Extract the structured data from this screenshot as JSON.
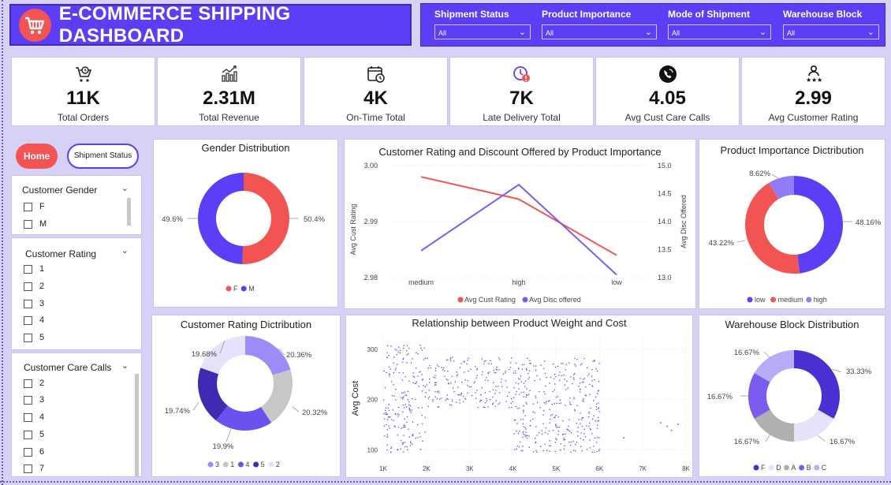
{
  "header": {
    "title": "E-COMMERCE SHIPPING DASHBOARD"
  },
  "filters": [
    {
      "label": "Shipment Status",
      "value": "All"
    },
    {
      "label": "Product Importance",
      "value": "All"
    },
    {
      "label": "Mode of Shipment",
      "value": "All"
    },
    {
      "label": "Warehouse Block",
      "value": "All"
    }
  ],
  "kpis": [
    {
      "value": "11K",
      "label": "Total Orders",
      "icon": "cart-clock-icon"
    },
    {
      "value": "2.31M",
      "label": "Total Revenue",
      "icon": "revenue-chart-icon"
    },
    {
      "value": "4K",
      "label": "On-Time Total",
      "icon": "calendar-clock-icon"
    },
    {
      "value": "7K",
      "label": "Late Delivery Total",
      "icon": "late-clock-icon"
    },
    {
      "value": "4.05",
      "label": "Avg Cust Care Calls",
      "icon": "phone-icon"
    },
    {
      "value": "2.99",
      "label": "Avg Customer Rating",
      "icon": "rating-person-icon"
    }
  ],
  "nav": {
    "home": "Home",
    "shipment": "Shipment Status"
  },
  "slicers": {
    "gender": {
      "title": "Customer Gender",
      "items": [
        "F",
        "M"
      ]
    },
    "rating": {
      "title": "Customer Rating",
      "items": [
        "1",
        "2",
        "3",
        "4",
        "5"
      ]
    },
    "calls": {
      "title": "Customer Care Calls",
      "items": [
        "2",
        "3",
        "4",
        "5",
        "6",
        "7"
      ]
    }
  },
  "colors": {
    "accent": "#5b3ef5",
    "red": "#f25454"
  },
  "chart_data": [
    {
      "id": "gender",
      "type": "pie",
      "title": "Gender Distribution",
      "slices": [
        {
          "label": "F",
          "value": 50.4,
          "display": "50.4%",
          "color": "#f25454"
        },
        {
          "label": "M",
          "value": 49.6,
          "display": "49.6%",
          "color": "#5b3ef5"
        }
      ],
      "legend": [
        "F",
        "M"
      ]
    },
    {
      "id": "rating_discount",
      "type": "line",
      "title": "Customer Rating and Discount Offered by Product Importance",
      "categories": [
        "medium",
        "high",
        "low"
      ],
      "series": [
        {
          "name": "Avg Cust Rating",
          "values": [
            2.998,
            2.994,
            2.984
          ],
          "axis": "left",
          "color": "#f25454"
        },
        {
          "name": "Avg Disc offered",
          "values": [
            13.48,
            14.66,
            13.05
          ],
          "axis": "right",
          "color": "#7b5cf0"
        }
      ],
      "ylabel": "Avg Cust Rating",
      "y2label": "Avg Disc Offered",
      "ylim": [
        2.98,
        3.0
      ],
      "y2lim": [
        13.0,
        15.0
      ],
      "yticks": [
        "2.98",
        "2.99",
        "3.00"
      ],
      "y2ticks": [
        "13.0",
        "13.5",
        "14.0",
        "14.5",
        "15.0"
      ]
    },
    {
      "id": "importance",
      "type": "pie",
      "title": "Product Importance Dictribution",
      "slices": [
        {
          "label": "low",
          "value": 48.16,
          "display": "48.16%",
          "color": "#5b3ef5"
        },
        {
          "label": "medium",
          "value": 43.22,
          "display": "43.22%",
          "color": "#f25454"
        },
        {
          "label": "high",
          "value": 8.62,
          "display": "8.62%",
          "color": "#8f7cf6"
        }
      ],
      "legend": [
        "low",
        "medium",
        "high"
      ]
    },
    {
      "id": "rating_dist",
      "type": "pie",
      "title": "Customer Rating Dictribution",
      "slices": [
        {
          "label": "3",
          "value": 20.36,
          "display": "20.36%",
          "color": "#9d8cf7"
        },
        {
          "label": "1",
          "value": 20.32,
          "display": "20.32%",
          "color": "#c7c7c7"
        },
        {
          "label": "4",
          "value": 19.9,
          "display": "19.9%",
          "color": "#6c50f0"
        },
        {
          "label": "5",
          "value": 19.74,
          "display": "19.74%",
          "color": "#3f2bb3"
        },
        {
          "label": "2",
          "value": 19.68,
          "display": "19.68%",
          "color": "#e5e2fb"
        }
      ],
      "legend": [
        "3",
        "1",
        "4",
        "5",
        "2"
      ]
    },
    {
      "id": "weight_cost",
      "type": "scatter",
      "title": "Relationship between Product Weight and Cost",
      "ylabel": "Avg Cost",
      "xlim": [
        1000,
        8000
      ],
      "ylim": [
        85,
        320
      ],
      "xticks": [
        "1K",
        "2K",
        "3K",
        "4K",
        "5K",
        "6K",
        "7K",
        "8K"
      ],
      "yticks": [
        "100",
        "200",
        "300"
      ],
      "clusters": [
        {
          "xrange": [
            1000,
            2000
          ],
          "yrange": [
            96,
            310
          ]
        },
        {
          "xrange": [
            2000,
            4000
          ],
          "yrange": [
            185,
            285
          ]
        },
        {
          "xrange": [
            4000,
            6000
          ],
          "yrange": [
            96,
            285
          ]
        }
      ],
      "outliers": [
        [
          6550,
          125
        ],
        [
          7400,
          155
        ],
        [
          7550,
          148
        ],
        [
          7650,
          140
        ],
        [
          7800,
          152
        ]
      ],
      "color": "#5b3ef5"
    },
    {
      "id": "warehouse",
      "type": "pie",
      "title": "Warehouse Block Distribution",
      "slices": [
        {
          "label": "F",
          "value": 33.33,
          "display": "33.33%",
          "color": "#4a2fd1"
        },
        {
          "label": "D",
          "value": 16.67,
          "display": "16.67%",
          "color": "#e5e2fb"
        },
        {
          "label": "A",
          "value": 16.67,
          "display": "16.67%",
          "color": "#b0b0b0"
        },
        {
          "label": "B",
          "value": 16.67,
          "display": "16.67%",
          "color": "#7b5cf0"
        },
        {
          "label": "C",
          "value": 16.67,
          "display": "16.67%",
          "color": "#b8abf8"
        }
      ],
      "legend": [
        "F",
        "D",
        "A",
        "B",
        "C"
      ]
    }
  ]
}
